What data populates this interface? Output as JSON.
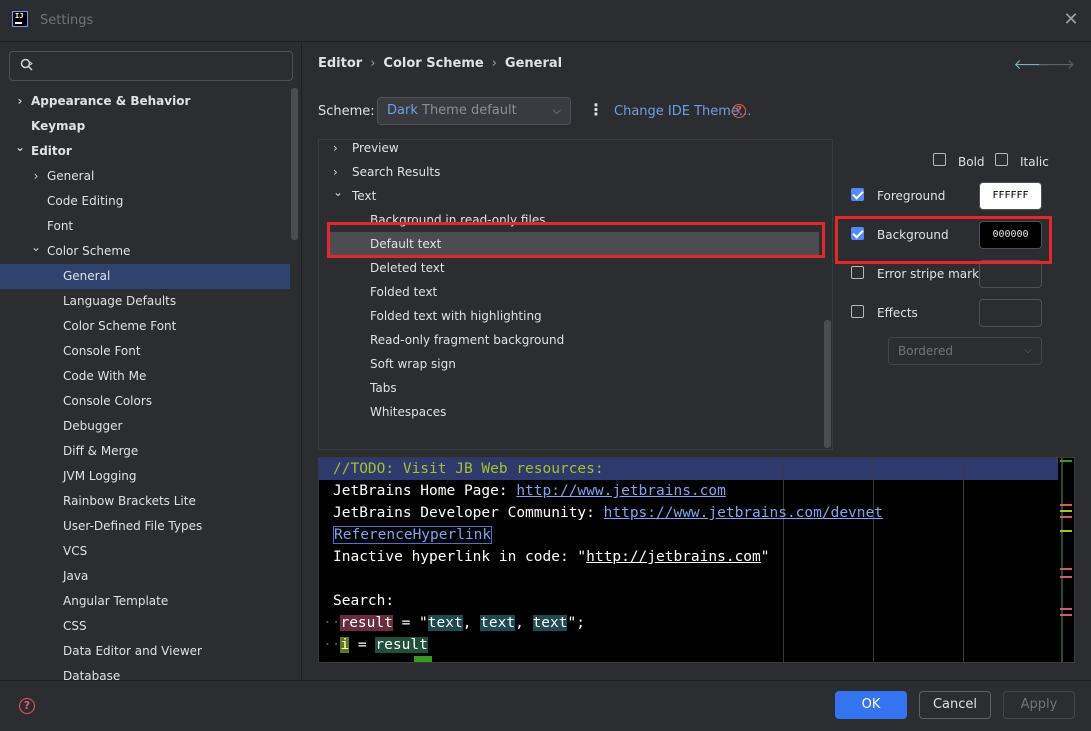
{
  "window": {
    "title": "Settings"
  },
  "search": {
    "placeholder": ""
  },
  "sidebar": {
    "items": [
      {
        "label": "Appearance & Behavior",
        "bold": true,
        "arrow": "›"
      },
      {
        "label": "Keymap",
        "bold": true
      },
      {
        "label": "Editor",
        "bold": true,
        "arrow": "⌄"
      },
      {
        "label": "General",
        "arrow": "›"
      },
      {
        "label": "Code Editing"
      },
      {
        "label": "Font"
      },
      {
        "label": "Color Scheme",
        "arrow": "⌄"
      },
      {
        "label": "General",
        "selected": true
      },
      {
        "label": "Language Defaults"
      },
      {
        "label": "Color Scheme Font"
      },
      {
        "label": "Console Font"
      },
      {
        "label": "Code With Me"
      },
      {
        "label": "Console Colors"
      },
      {
        "label": "Debugger"
      },
      {
        "label": "Diff & Merge"
      },
      {
        "label": "JVM Logging"
      },
      {
        "label": "Rainbow Brackets Lite"
      },
      {
        "label": "User-Defined File Types"
      },
      {
        "label": "VCS"
      },
      {
        "label": "Java"
      },
      {
        "label": "Angular Template"
      },
      {
        "label": "CSS"
      },
      {
        "label": "Data Editor and Viewer"
      },
      {
        "label": "Database"
      }
    ]
  },
  "breadcrumb": {
    "items": [
      "Editor",
      "Color Scheme",
      "General"
    ]
  },
  "scheme": {
    "label": "Scheme:",
    "value_part1": "Dark",
    "value_part2": "Theme default",
    "change_ide_theme": "Change IDE Theme..."
  },
  "attributes": {
    "items": [
      {
        "label": "Preview",
        "arrow": "›"
      },
      {
        "label": "Search Results",
        "arrow": "›"
      },
      {
        "label": "Text",
        "arrow": "⌄"
      },
      {
        "label": "Background in read-only files"
      },
      {
        "label": "Default text",
        "selected": true
      },
      {
        "label": "Deleted text"
      },
      {
        "label": "Folded text"
      },
      {
        "label": "Folded text with highlighting"
      },
      {
        "label": "Read-only fragment background"
      },
      {
        "label": "Soft wrap sign"
      },
      {
        "label": "Tabs"
      },
      {
        "label": "Whitespaces"
      }
    ]
  },
  "options": {
    "bold": "Bold",
    "italic": "Italic",
    "foreground": {
      "label": "Foreground",
      "checked": true,
      "value": "FFFFFF",
      "color": "#ffffff"
    },
    "background": {
      "label": "Background",
      "checked": true,
      "value": "000000",
      "color": "#000000"
    },
    "error_stripe": {
      "label": "Error stripe mark",
      "checked": false
    },
    "effects": {
      "label": "Effects",
      "checked": false,
      "type": "Bordered"
    }
  },
  "preview": {
    "todo": "//TODO: Visit JB Web resources:",
    "home_label": "JetBrains Home Page: ",
    "home_url": "http://www.jetbrains.com",
    "dev_label": "JetBrains Developer Community: ",
    "dev_url": "https://www.jetbrains.com/devnet",
    "ref": "ReferenceHyperlink",
    "inactive_label": "Inactive hyperlink in code: \"",
    "inactive_url": "http://jetbrains.com",
    "inactive_end": "\"",
    "search_label": "Search:",
    "dots": "··",
    "result": "result",
    "eq": " = \"",
    "text": "text",
    "comma": ", ",
    "end": "\";",
    "i": "i",
    "eq2": " = "
  },
  "footer": {
    "ok": "OK",
    "cancel": "Cancel",
    "apply": "Apply"
  },
  "colors": {
    "accent": "#3574f0",
    "highlight": "#e5262c",
    "selection": "#2e436e"
  }
}
